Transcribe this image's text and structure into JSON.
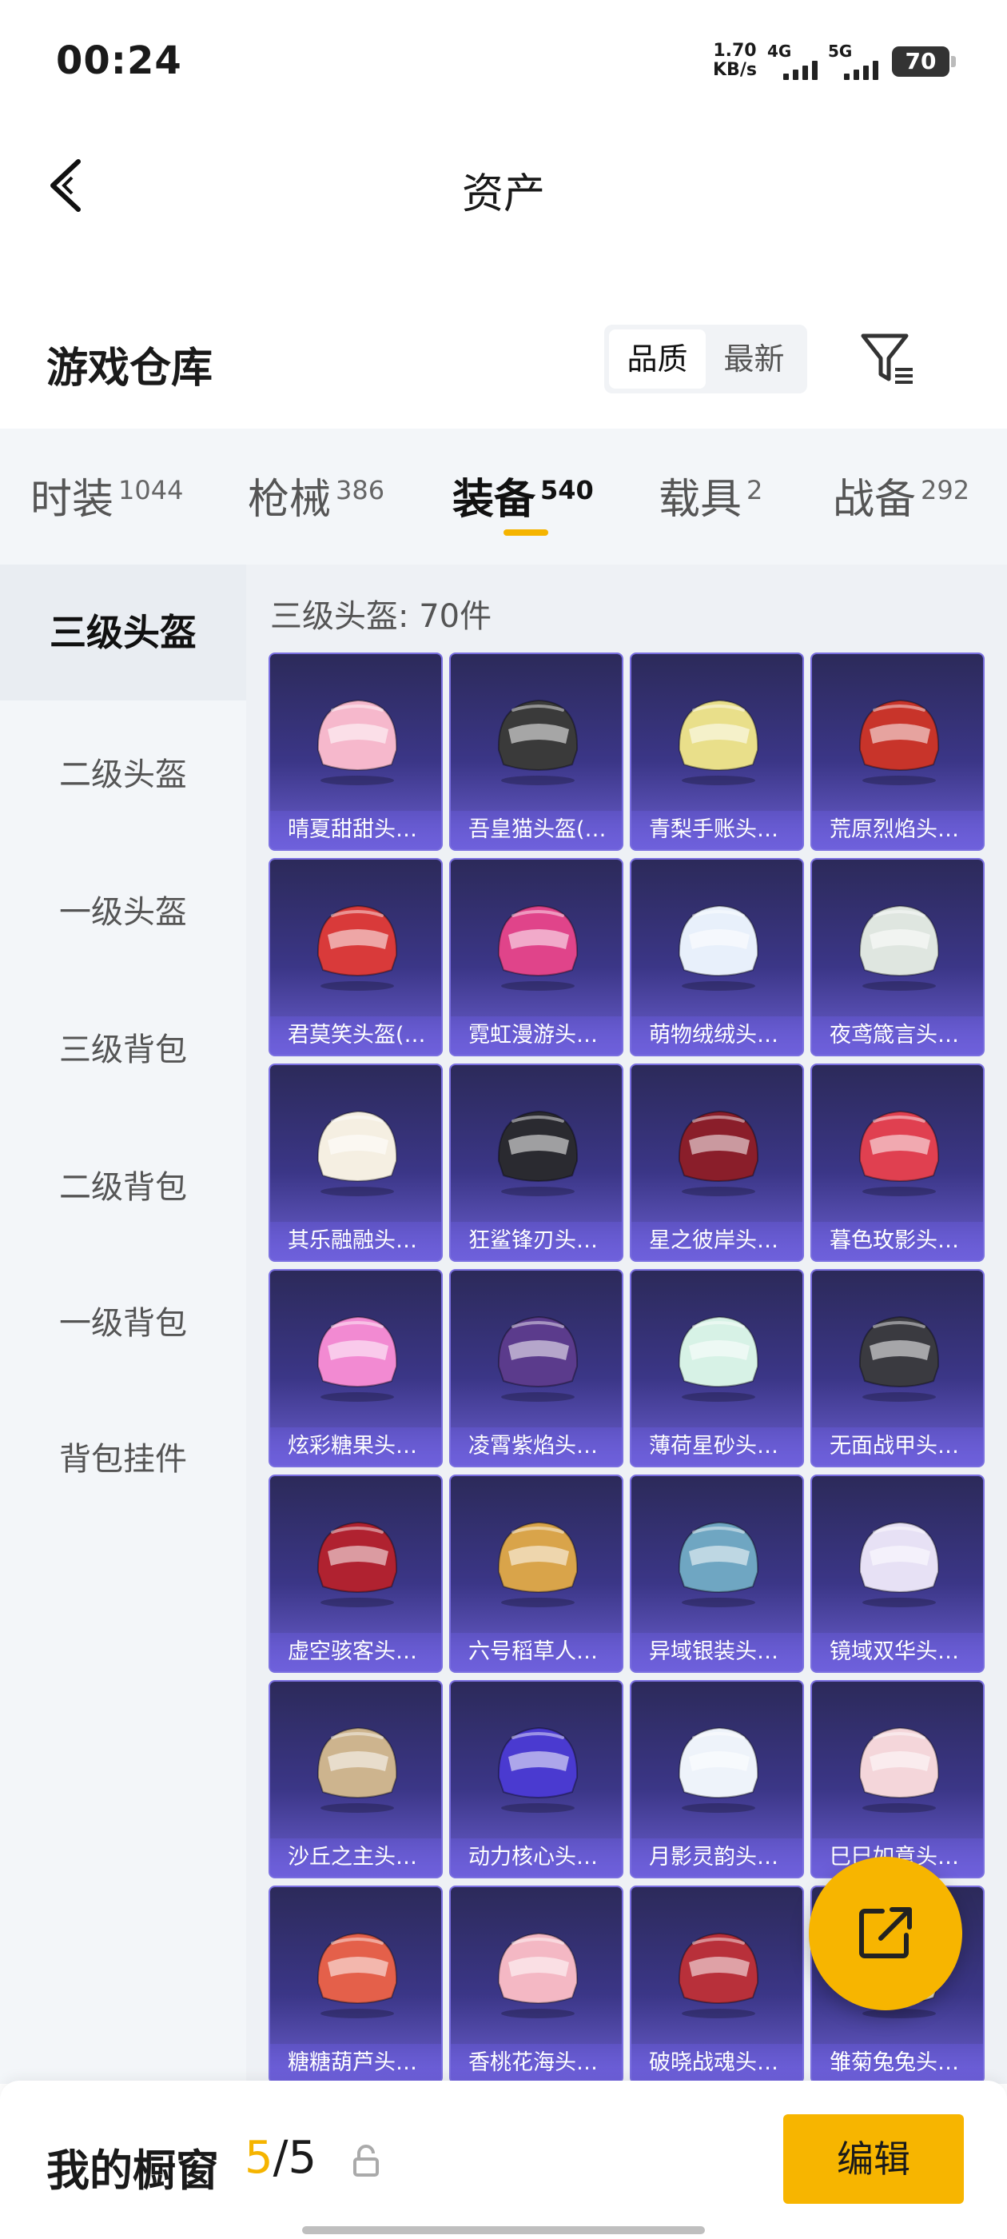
{
  "status_bar": {
    "time": "00:24",
    "net_speed_value": "1.70",
    "net_speed_unit": "KB/s",
    "signal1": "4G",
    "signal2": "5G",
    "battery": "70"
  },
  "header": {
    "title": "资产",
    "back_icon": "chevron-left-icon"
  },
  "warehouse": {
    "title": "游戏仓库",
    "sort_options": [
      "品质",
      "最新"
    ],
    "selected_sort": "品质",
    "filter_icon": "filter-icon"
  },
  "tabs": [
    {
      "label": "时装",
      "count": "1044"
    },
    {
      "label": "枪械",
      "count": "386"
    },
    {
      "label": "装备",
      "count": "540",
      "active": true
    },
    {
      "label": "载具",
      "count": "2"
    },
    {
      "label": "战备",
      "count": "292"
    }
  ],
  "sidebar": {
    "items": [
      "三级头盔",
      "二级头盔",
      "一级头盔",
      "三级背包",
      "二级背包",
      "一级背包",
      "背包挂件"
    ],
    "active": "三级头盔"
  },
  "section_title": "三级头盔: 70件",
  "items": [
    {
      "name": "晴夏甜甜头…",
      "color": "#f6b8cc"
    },
    {
      "name": "吾皇猫头盔(…",
      "color": "#3a3a3a"
    },
    {
      "name": "青梨手账头…",
      "color": "#e9df8a"
    },
    {
      "name": "荒原烈焰头…",
      "color": "#c8342a"
    },
    {
      "name": "君莫笑头盔(…",
      "color": "#d93a3a"
    },
    {
      "name": "霓虹漫游头…",
      "color": "#e0448a"
    },
    {
      "name": "萌物绒绒头…",
      "color": "#e8f0fb"
    },
    {
      "name": "夜鸢箴言头…",
      "color": "#dfe6e0"
    },
    {
      "name": "其乐融融头…",
      "color": "#f5efe2"
    },
    {
      "name": "狂鲨锋刃头…",
      "color": "#2a2a30"
    },
    {
      "name": "星之彼岸头…",
      "color": "#8a1e2a"
    },
    {
      "name": "暮色玫影头…",
      "color": "#e04050"
    },
    {
      "name": "炫彩糖果头…",
      "color": "#f28ad2"
    },
    {
      "name": "凌霄紫焰头…",
      "color": "#5b3b8c"
    },
    {
      "name": "薄荷星砂头…",
      "color": "#d7f2e6"
    },
    {
      "name": "无面战甲头…",
      "color": "#3a3a40"
    },
    {
      "name": "虚空骇客头…",
      "color": "#b02230"
    },
    {
      "name": "六号稻草人…",
      "color": "#d9a44a"
    },
    {
      "name": "异域银装头…",
      "color": "#6fa6c2"
    },
    {
      "name": "镜域双华头…",
      "color": "#e7e1f5"
    },
    {
      "name": "沙丘之主头…",
      "color": "#cdb48e"
    },
    {
      "name": "动力核心头…",
      "color": "#4a3ad0"
    },
    {
      "name": "月影灵韵头…",
      "color": "#eef3fa"
    },
    {
      "name": "巳巳如意头…",
      "color": "#f4d6da"
    },
    {
      "name": "糖糖葫芦头…",
      "color": "#e4604a"
    },
    {
      "name": "香桃花海头…",
      "color": "#f4b8c4"
    },
    {
      "name": "破晓战魂头…",
      "color": "#b8303a"
    },
    {
      "name": "雏菊兔兔头…",
      "color": "#f3efe4"
    }
  ],
  "fab_icon": "share-external-icon",
  "bottom_bar": {
    "label": "我的橱窗",
    "current": "5",
    "separator": "/",
    "total": "5",
    "lock_icon": "lock-icon",
    "edit_label": "编辑"
  },
  "colors": {
    "accent": "#f7b500",
    "card_bg": "#3b3687",
    "card_border": "#7a6fe0"
  }
}
